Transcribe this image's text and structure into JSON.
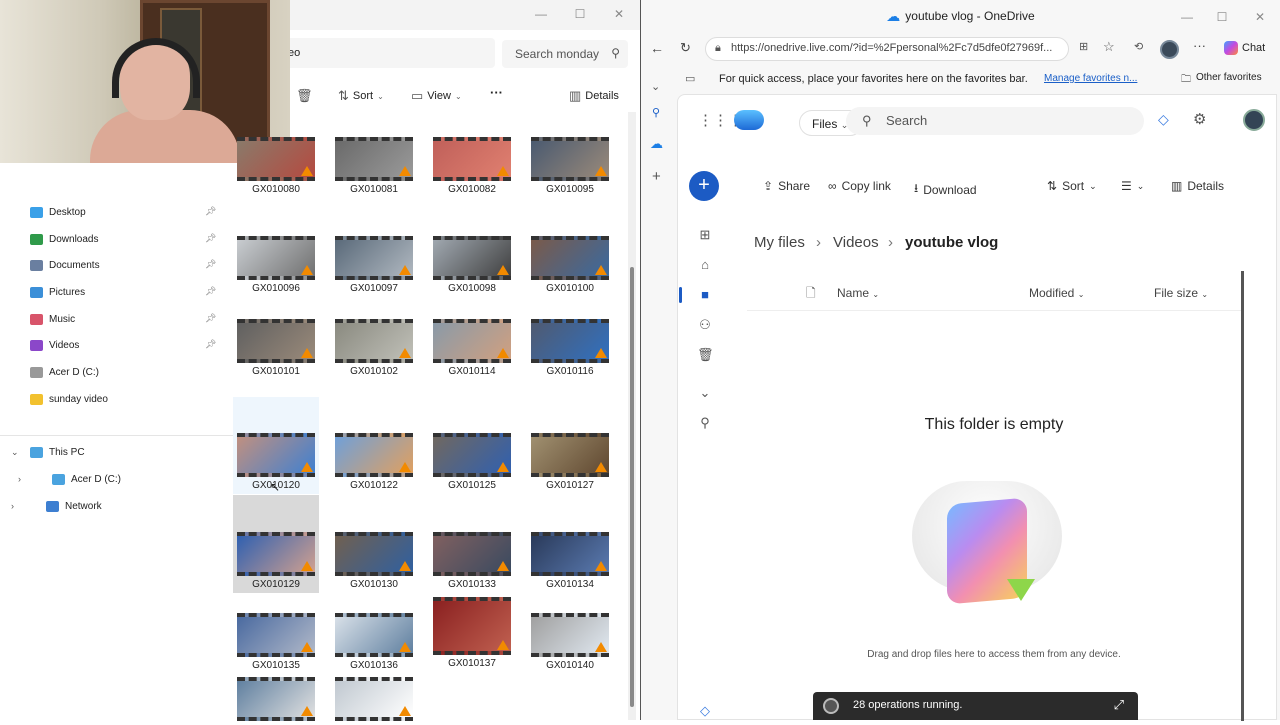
{
  "explorer": {
    "address_fragment": "eo",
    "search_placeholder": "Search monday",
    "cmd": {
      "sort": "Sort",
      "view": "View",
      "more": "···",
      "details": "Details"
    },
    "nav": {
      "items": [
        {
          "label": "Desktop",
          "color": "#3aa0e8",
          "pinned": true
        },
        {
          "label": "Downloads",
          "color": "#2f9a4a",
          "pinned": true
        },
        {
          "label": "Documents",
          "color": "#6a7fa0",
          "pinned": true
        },
        {
          "label": "Pictures",
          "color": "#3b8fd8",
          "pinned": true
        },
        {
          "label": "Music",
          "color": "#d8546a",
          "pinned": true
        },
        {
          "label": "Videos",
          "color": "#8b47c9",
          "pinned": true
        },
        {
          "label": "Acer D  (C:)",
          "color": "#999999",
          "pinned": false
        },
        {
          "label": "sunday video",
          "color": "#f2c12e",
          "pinned": false
        }
      ],
      "tree": [
        {
          "label": "This PC",
          "expanded": true
        },
        {
          "label": "Acer D  (C:)",
          "expanded": false
        },
        {
          "label": "Network",
          "expanded": false
        }
      ]
    },
    "files": [
      "GX010080",
      "GX010081",
      "GX010082",
      "GX010095",
      "GX010096",
      "GX010097",
      "GX010098",
      "GX010100",
      "GX010101",
      "GX010102",
      "GX010114",
      "GX010116",
      "GX010120",
      "GX010122",
      "GX010125",
      "GX010127",
      "GX010129",
      "GX010130",
      "GX010133",
      "GX010134",
      "GX010135",
      "GX010136",
      "GX010137",
      "GX010140",
      "",
      ""
    ]
  },
  "browser": {
    "title": "youtube vlog - OneDrive",
    "url": "https://onedrive.live.com/?id=%2Fpersonal%2Fc7d5dfe0f27969f...",
    "favbar_text": "For quick access, place your favorites here on the favorites bar.",
    "favbar_link": "Manage favorites n...",
    "other_favorites": "Other favorites",
    "chat": "Chat"
  },
  "onedrive": {
    "files_filter": "Files",
    "search_placeholder": "Search",
    "cmd": {
      "share": "Share",
      "copy_link": "Copy link",
      "download": "Download",
      "sort": "Sort",
      "details": "Details"
    },
    "breadcrumb": [
      "My files",
      "Videos",
      "youtube vlog"
    ],
    "columns": {
      "name": "Name",
      "modified": "Modified",
      "size": "File size"
    },
    "empty_title": "This folder is empty",
    "empty_sub": "Drag and drop files here to access them from any device.",
    "toast": "28 operations running."
  }
}
